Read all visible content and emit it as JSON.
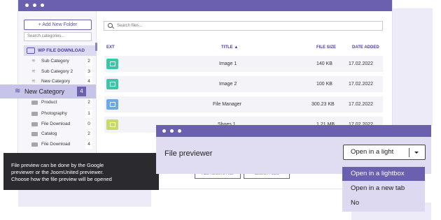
{
  "sidebar": {
    "add_folder": "+ Add New Folder",
    "search_placeholder": "Search categories...",
    "root": "WP FILE DOWNLOAD",
    "categories": [
      {
        "label": "Sub Category",
        "count": "2"
      },
      {
        "label": "Sub Category 2",
        "count": "3"
      },
      {
        "label": "New Category",
        "count": "4"
      },
      {
        "label": "Product",
        "count": "2"
      },
      {
        "label": "Photography",
        "count": "1"
      },
      {
        "label": "File Download",
        "count": "0"
      },
      {
        "label": "Catalog",
        "count": "2"
      },
      {
        "label": "File Download",
        "count": "4"
      }
    ],
    "highlighted": {
      "label": "New Category",
      "count": "4"
    }
  },
  "main": {
    "search_placeholder": "Search files...",
    "columns": {
      "ext": "EXT",
      "title": "TITLE ▲",
      "size": "FILE SIZE",
      "date": "DATE ADDED"
    },
    "files": [
      {
        "title": "Image 1",
        "size": "140 KB",
        "date": "17.02.2022",
        "color": "#3cc6a8"
      },
      {
        "title": "Image 2",
        "size": "100 KB",
        "date": "17.02.2022",
        "color": "#3cc6a8"
      },
      {
        "title": "File Manager",
        "size": "300.23 KB",
        "date": "17.02.2022",
        "color": "#6aa8ee"
      },
      {
        "title": "Shoes 1",
        "size": "1.21 MB",
        "date": "17.02.2022",
        "color": "#c5dc6a"
      }
    ],
    "add_remote": "ADD REMOTE FILE",
    "select_files": "SELECT FILES"
  },
  "tooltip": {
    "line1": "File preview can be done by the Google",
    "line2": "previewer or the JoomUnited previewer.",
    "line3": "Choose how the file preview will be opened"
  },
  "previewer": {
    "label": "File previewer",
    "selected": "Open in a light",
    "options": [
      "Open in a lightbox",
      "Open in a new tab",
      "No"
    ]
  },
  "colors": {
    "accent": "#6b5fb0",
    "highlight": "#c7c4ea",
    "tooltip_bg": "#2b2b2f"
  }
}
